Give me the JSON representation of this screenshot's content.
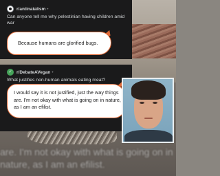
{
  "post_1": {
    "subreddit": "r/antinatalism",
    "separator": "•",
    "title": "Can anyone tell me why pelestinian having children amid war",
    "reply": "Because humans are glorified bugs."
  },
  "post_2": {
    "subreddit": "r/DebateAVegan",
    "separator": "•",
    "title": "What justifies non-human animals eating meat?",
    "reply": "I would say it is not justified, just the way things are. I'm not okay with what is going on in nature, as I am an efilist."
  },
  "background_text": {
    "line_1": "are. I'm not okay with what is going on in",
    "line_2": "nature, as I am an efilist."
  },
  "icons": {
    "post_1_avatar": "antinatalism-subreddit-icon",
    "post_2_avatar": "debateavegan-subreddit-icon"
  },
  "colors": {
    "card_background": "#1a1a1b",
    "card_text": "#d7dadc",
    "bubble_border": "#e06a37",
    "bubble_fill": "#ffffff",
    "vegan_avatar": "#46a35a"
  }
}
